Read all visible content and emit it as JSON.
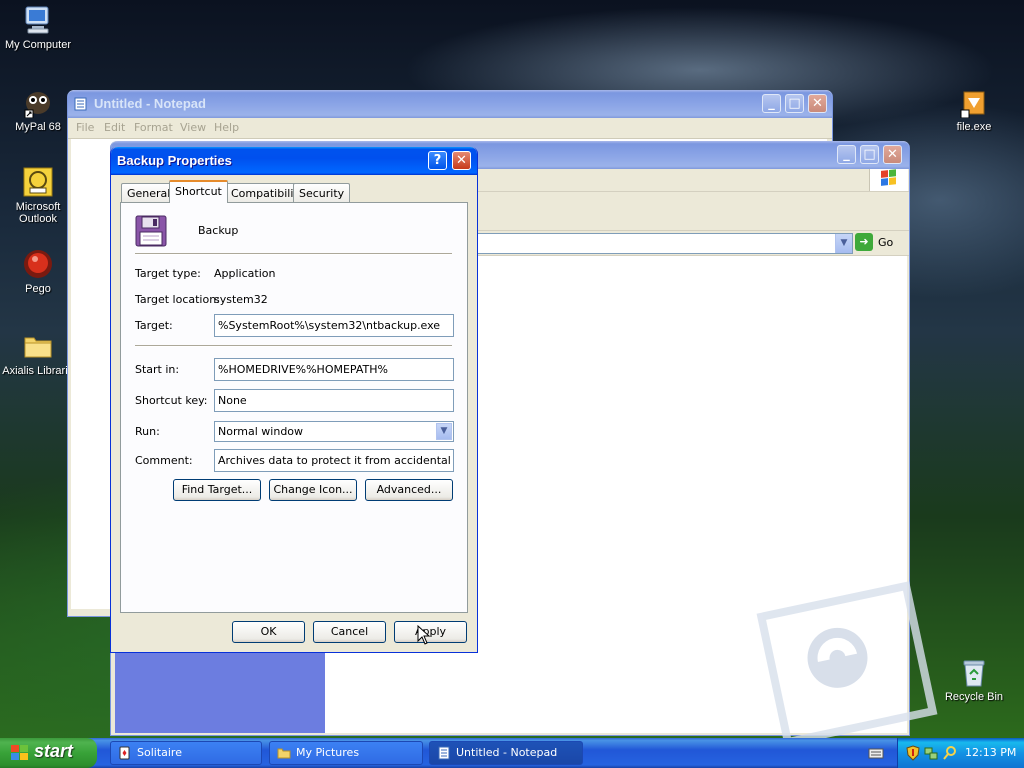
{
  "desktop": {
    "icons": [
      {
        "label": "My Computer"
      },
      {
        "label": "MyPal 68"
      },
      {
        "label": "Microsoft Outlook"
      },
      {
        "label": "Pego"
      },
      {
        "label": "Axialis Librarie"
      },
      {
        "label": "file.exe"
      },
      {
        "label": "Recycle Bin"
      }
    ]
  },
  "notepad": {
    "title": "Untitled - Notepad",
    "menu": [
      "File",
      "Edit",
      "Format",
      "View",
      "Help"
    ]
  },
  "explorer": {
    "address_go": "Go"
  },
  "dialog": {
    "title": "Backup Properties",
    "tabs": [
      "General",
      "Shortcut",
      "Compatibility",
      "Security"
    ],
    "active_tab": "Shortcut",
    "shortcut_name": "Backup",
    "target_type_label": "Target type:",
    "target_type_value": "Application",
    "target_location_label": "Target location:",
    "target_location_value": "system32",
    "target_label": "Target:",
    "target_value": "%SystemRoot%\\system32\\ntbackup.exe",
    "start_in_label": "Start in:",
    "start_in_value": "%HOMEDRIVE%%HOMEPATH%",
    "shortcut_key_label": "Shortcut key:",
    "shortcut_key_value": "None",
    "run_label": "Run:",
    "run_value": "Normal window",
    "comment_label": "Comment:",
    "comment_value": "Archives data to protect it from accidental loss.",
    "find_target": "Find Target...",
    "change_icon": "Change Icon...",
    "advanced": "Advanced...",
    "ok": "OK",
    "cancel": "Cancel",
    "apply": "Apply"
  },
  "taskbar": {
    "start": "start",
    "tasks": [
      {
        "label": "Solitaire"
      },
      {
        "label": "My Pictures"
      },
      {
        "label": "Untitled - Notepad"
      }
    ],
    "clock": "12:13 PM"
  },
  "colors": {
    "xp_blue": "#0054e3",
    "dialog_face": "#ece9d8",
    "tab_highlight": "#e68b2c",
    "start_green": "#3c9a3c"
  }
}
